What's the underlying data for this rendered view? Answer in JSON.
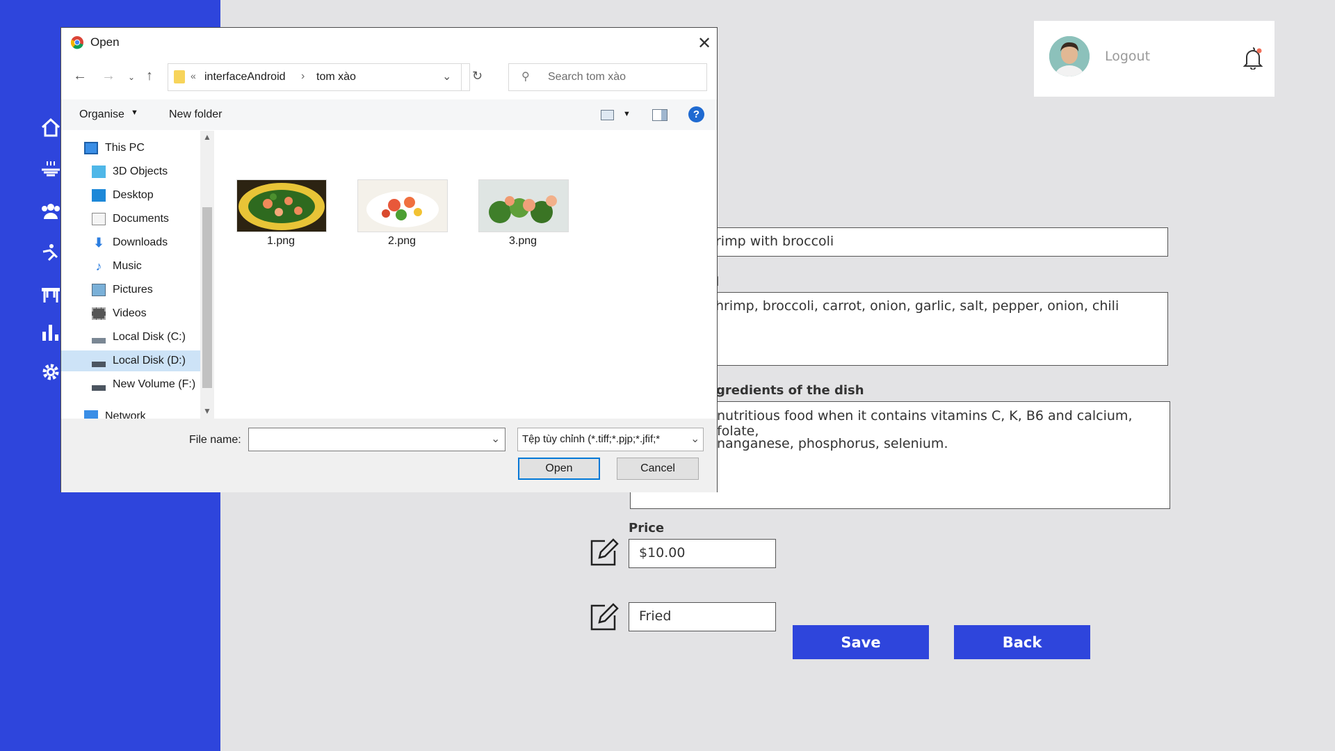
{
  "header": {
    "logout_label": "Logout"
  },
  "form": {
    "name_value": "rimp with broccoli",
    "ingredients_label": "l",
    "ingredients_value": "hrimp, broccoli, carrot, onion, garlic, salt, pepper, onion, chili",
    "nutrition_label": "gredients of the dish",
    "nutrition_line1": "nutritious food when it contains vitamins C, K, B6 and calcium, folate,",
    "nutrition_line2": "nanganese, phosphorus, selenium.",
    "price_label": "Price",
    "price_value": "$10.00",
    "method_value": "Fried",
    "save_label": "Save",
    "back_label": "Back"
  },
  "dialog": {
    "title": "Open",
    "breadcrumb_prefix": "«",
    "breadcrumb_1": "interfaceAndroid",
    "breadcrumb_sep": "›",
    "breadcrumb_2": "tom xào",
    "search_placeholder": "Search tom xào",
    "organise_label": "Organise",
    "new_folder_label": "New folder",
    "nav_items": [
      {
        "label": "This PC",
        "icon": "pc-icon"
      },
      {
        "label": "3D Objects",
        "icon": "cube-icon"
      },
      {
        "label": "Desktop",
        "icon": "desktop-icon"
      },
      {
        "label": "Documents",
        "icon": "document-icon"
      },
      {
        "label": "Downloads",
        "icon": "download-icon"
      },
      {
        "label": "Music",
        "icon": "music-icon"
      },
      {
        "label": "Pictures",
        "icon": "pictures-icon"
      },
      {
        "label": "Videos",
        "icon": "video-icon"
      },
      {
        "label": "Local Disk (C:)",
        "icon": "drive-icon"
      },
      {
        "label": "Local Disk (D:)",
        "icon": "drive-icon",
        "selected": true
      },
      {
        "label": "New Volume (F:)",
        "icon": "drive-icon"
      },
      {
        "label": "Network",
        "icon": "network-icon"
      }
    ],
    "files": [
      {
        "name": "1.png"
      },
      {
        "name": "2.png"
      },
      {
        "name": "3.png"
      }
    ],
    "file_name_label": "File name:",
    "file_name_value": "",
    "file_type_value": "Tệp tùy chỉnh (*.tiff;*.pjp;*.jfif;*",
    "open_label": "Open",
    "cancel_label": "Cancel"
  },
  "colors": {
    "accent": "#2e45dc",
    "background": "#e3e3e5"
  }
}
